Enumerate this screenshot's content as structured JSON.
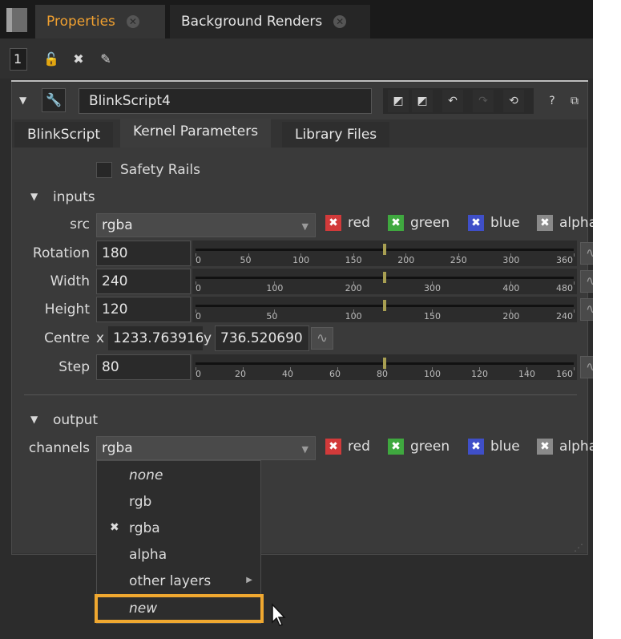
{
  "tabs": {
    "properties": "Properties",
    "background_renders": "Background Renders"
  },
  "toolbar": {
    "panel_count": "1"
  },
  "node": {
    "name": "BlinkScript4"
  },
  "subtabs": [
    "BlinkScript",
    "Kernel Parameters",
    "Library Files"
  ],
  "kernel": {
    "safety_rails": "Safety Rails",
    "inputs_header": "inputs",
    "src_label": "src",
    "src_value": "rgba",
    "channels": [
      "red",
      "green",
      "blue",
      "alpha"
    ],
    "rotation_label": "Rotation",
    "rotation_value": "180",
    "rotation_ticks": [
      "0",
      "50",
      "100",
      "150",
      "200",
      "250",
      "300",
      "360"
    ],
    "width_label": "Width",
    "width_value": "240",
    "width_ticks": [
      "0",
      "100",
      "200",
      "300",
      "400",
      "480"
    ],
    "height_label": "Height",
    "height_value": "120",
    "height_ticks": [
      "0",
      "50",
      "100",
      "150",
      "200",
      "240"
    ],
    "centre_label": "Centre",
    "centre_x_label": "x",
    "centre_x_value": "1233.763916",
    "centre_y_label": "y",
    "centre_y_value": "736.520690",
    "step_label": "Step",
    "step_value": "80",
    "step_ticks": [
      "0",
      "20",
      "40",
      "60",
      "80",
      "100",
      "120",
      "140",
      "160"
    ],
    "output_header": "output",
    "out_channels_label": "channels",
    "out_channels_value": "rgba"
  },
  "menu": {
    "items": [
      "none",
      "rgb",
      "rgba",
      "alpha",
      "other layers",
      "new"
    ],
    "selected": "rgba"
  },
  "colors": {
    "accent": "#f0a030",
    "red": "#d23a3a",
    "green": "#3fa83f",
    "blue": "#3f4fc8",
    "alpha": "#8a8a8a"
  }
}
